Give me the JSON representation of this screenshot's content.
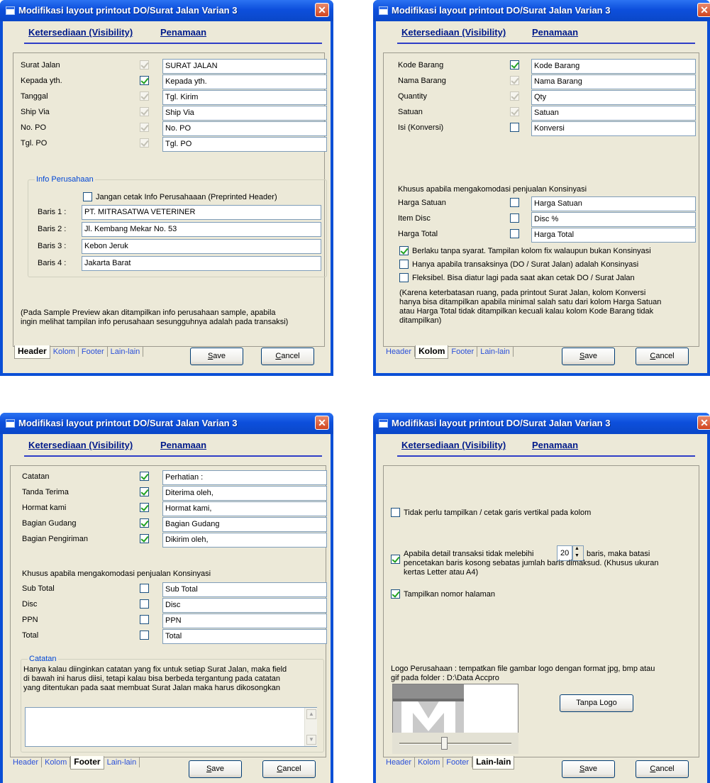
{
  "window_title": "Modifikasi layout printout DO/Surat Jalan Varian 3",
  "close_glyph": "✕",
  "header_tabs": {
    "visibility": "Ketersediaan (Visibility)",
    "naming": "Penamaan"
  },
  "bottom_tabs": [
    "Header",
    "Kolom",
    "Footer",
    "Lain-lain"
  ],
  "buttons": {
    "save_prefix": "",
    "save_key": "S",
    "save_rest": "ave",
    "cancel_key": "C",
    "cancel_rest": "ancel"
  },
  "header_panel": {
    "rows": [
      {
        "label": "Surat Jalan",
        "checked": true,
        "disabled": true,
        "value": "SURAT JALAN"
      },
      {
        "label": "Kepada yth.",
        "checked": true,
        "disabled": false,
        "value": "Kepada yth."
      },
      {
        "label": "Tanggal",
        "checked": true,
        "disabled": true,
        "value": "Tgl. Kirim"
      },
      {
        "label": "Ship Via",
        "checked": true,
        "disabled": true,
        "value": "Ship Via"
      },
      {
        "label": "No. PO",
        "checked": true,
        "disabled": true,
        "value": "No. PO"
      },
      {
        "label": "Tgl. PO",
        "checked": true,
        "disabled": true,
        "value": "Tgl. PO"
      }
    ],
    "group_caption": "Info Perusahaan",
    "no_print_label": "Jangan cetak Info Perusahaaan (Preprinted Header)",
    "baris": [
      {
        "label": "Baris 1 :",
        "value": "PT. MITRASATWA VETERINER"
      },
      {
        "label": "Baris 2 :",
        "value": "Jl. Kembang Mekar No. 53"
      },
      {
        "label": "Baris 3 :",
        "value": "Kebon Jeruk"
      },
      {
        "label": "Baris 4 :",
        "value": "Jakarta Barat"
      }
    ],
    "note_line1": "(Pada Sample Preview akan ditampilkan info perusahaan sample, apabila",
    "note_line2": "ingin melihat tampilan info perusahaan sesungguhnya adalah pada transaksi)"
  },
  "kolom_panel": {
    "rows": [
      {
        "label": "Kode Barang",
        "checked": true,
        "disabled": false,
        "value": "Kode Barang"
      },
      {
        "label": "Nama Barang",
        "checked": true,
        "disabled": true,
        "value": "Nama Barang"
      },
      {
        "label": "Quantity",
        "checked": true,
        "disabled": true,
        "value": "Qty"
      },
      {
        "label": "Satuan",
        "checked": true,
        "disabled": true,
        "value": "Satuan"
      },
      {
        "label": "Isi (Konversi)",
        "checked": false,
        "disabled": false,
        "value": "Konversi"
      }
    ],
    "konsinyasi_caption": "Khusus apabila mengakomodasi penjualan Konsinyasi",
    "konsinyasi_rows": [
      {
        "label": "Harga Satuan",
        "checked": false,
        "value": "Harga Satuan"
      },
      {
        "label": "Item Disc",
        "checked": false,
        "value": "Disc %"
      },
      {
        "label": "Harga Total",
        "checked": false,
        "value": "Harga Total"
      }
    ],
    "options": [
      {
        "label": "Berlaku tanpa syarat. Tampilan kolom fix walaupun bukan Konsinyasi",
        "checked": true
      },
      {
        "label": "Hanya apabila transaksinya (DO / Surat Jalan) adalah Konsinyasi",
        "checked": false
      },
      {
        "label": "Fleksibel. Bisa diatur lagi pada saat akan cetak DO / Surat Jalan",
        "checked": false
      }
    ],
    "note": [
      "(Karena keterbatasan ruang, pada printout Surat Jalan, kolom Konversi",
      "hanya bisa ditampilkan apabila minimal salah satu dari kolom Harga Satuan",
      "atau Harga Total tidak ditampilkan kecuali kalau kolom Kode Barang tidak",
      "ditampilkan)"
    ]
  },
  "footer_panel": {
    "rows": [
      {
        "label": "Catatan",
        "checked": true,
        "value": "Perhatian :"
      },
      {
        "label": "Tanda Terima",
        "checked": true,
        "value": "Diterima oleh,"
      },
      {
        "label": "Hormat kami",
        "checked": true,
        "value": "Hormat kami,"
      },
      {
        "label": "Bagian Gudang",
        "checked": true,
        "value": "Bagian Gudang"
      },
      {
        "label": "Bagian Pengiriman",
        "checked": true,
        "value": "Dikirim oleh,"
      }
    ],
    "konsinyasi_caption": "Khusus apabila mengakomodasi penjualan Konsinyasi",
    "konsinyasi_rows": [
      {
        "label": "Sub Total",
        "checked": false,
        "value": "Sub Total"
      },
      {
        "label": "Disc",
        "checked": false,
        "value": "Disc"
      },
      {
        "label": "PPN",
        "checked": false,
        "value": "PPN"
      },
      {
        "label": "Total",
        "checked": false,
        "value": "Total"
      }
    ],
    "group_caption": "Catatan",
    "catatan_note": [
      "Hanya kalau diinginkan catatan yang fix untuk setiap Surat Jalan, maka field",
      "di bawah ini harus diisi, tetapi kalau bisa berbeda tergantung pada catatan",
      "yang ditentukan pada saat membuat Surat Jalan maka harus dikosongkan"
    ],
    "catatan_text": ""
  },
  "lain_panel": {
    "no_vertical_lines": {
      "label": "Tidak perlu tampilkan / cetak garis vertikal pada kolom",
      "checked": false
    },
    "limit": {
      "checked": true,
      "text_before": "Apabila detail transaksi tidak melebihi",
      "rows_value": "20",
      "text_after": "baris, maka batasi",
      "line2": "pencetakan baris kosong sebatas jumlah baris dimaksud. (Khusus ukuran",
      "line3": "kertas Letter atau A4)"
    },
    "page_number": {
      "label": "Tampilkan nomor halaman",
      "checked": true
    },
    "logo_line1": "Logo Perusahaan : tempatkan file gambar logo dengan format jpg, bmp atau",
    "logo_line2": "gif pada folder : D:\\Data Accpro",
    "no_logo_button": "Tanpa Logo",
    "logo_scale_fraction": 0.4
  }
}
